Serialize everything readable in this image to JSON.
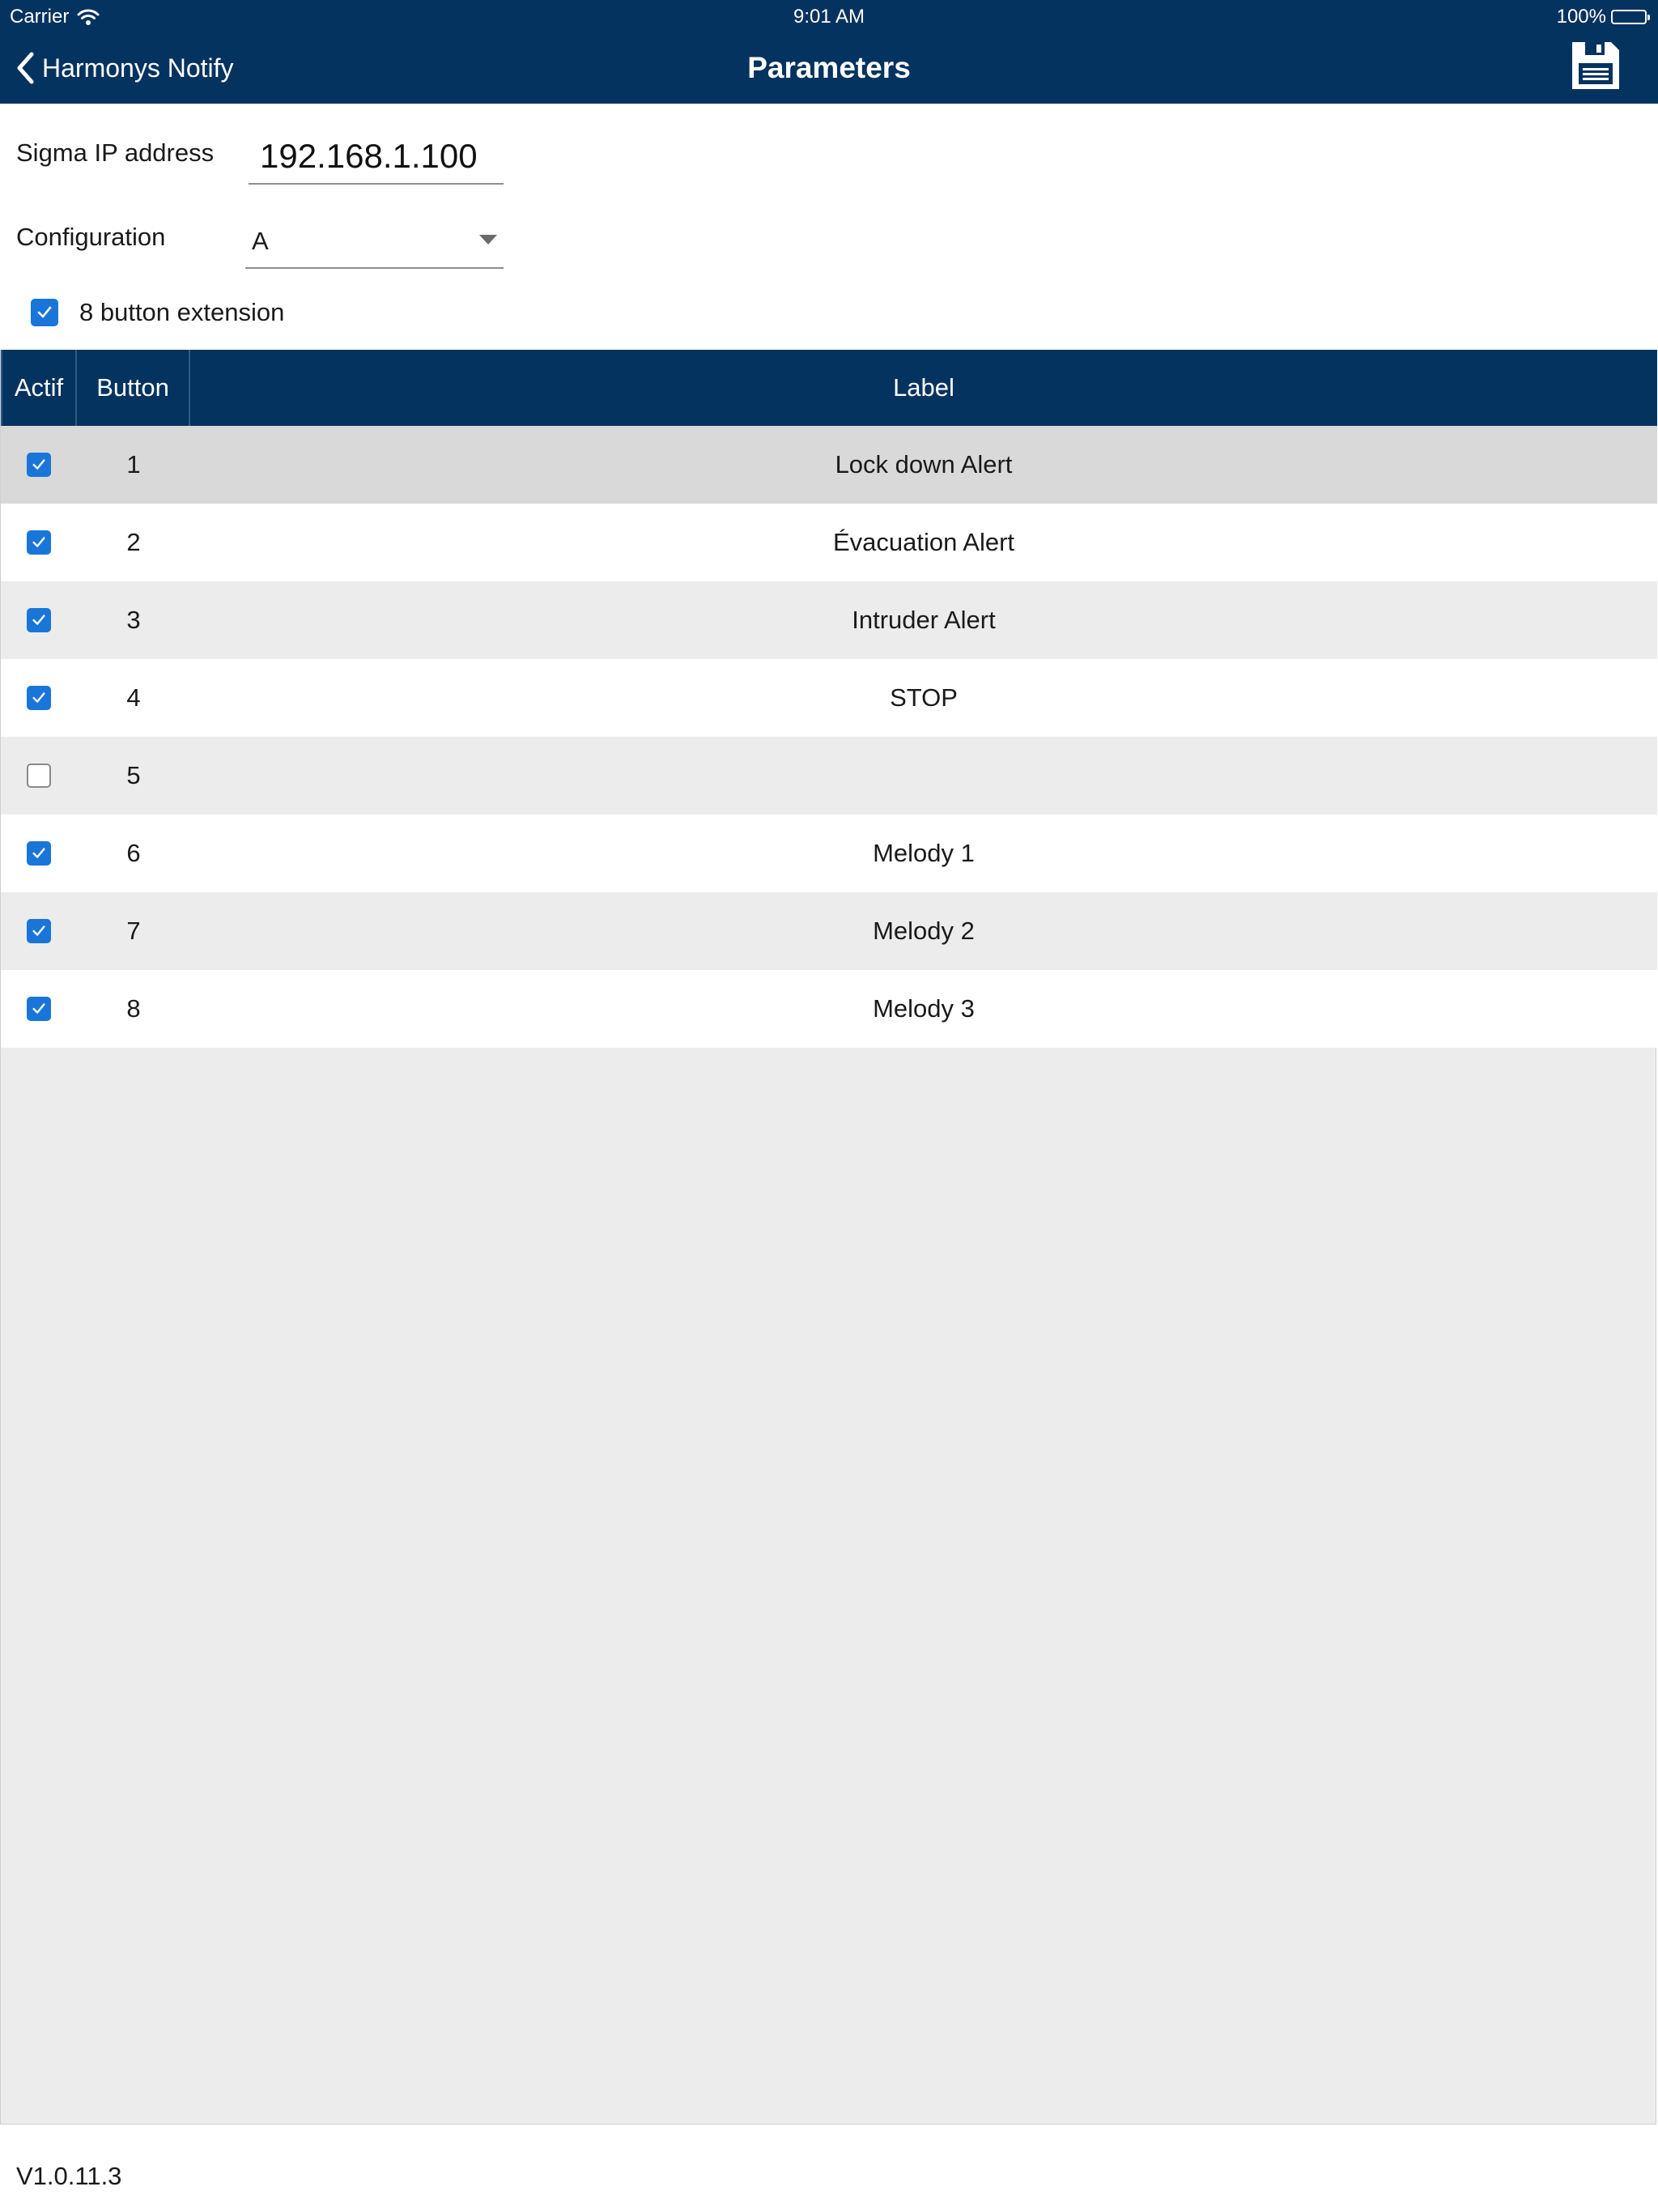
{
  "status_bar": {
    "carrier": "Carrier",
    "time": "9:01 AM",
    "battery": "100%"
  },
  "nav": {
    "back_label": "Harmonys Notify",
    "title": "Parameters",
    "save_icon": "floppy-disk-icon"
  },
  "form": {
    "ip_label": "Sigma IP address",
    "ip_value": "192.168.1.100",
    "config_label": "Configuration",
    "config_value": "A",
    "extension_label": "8 button extension",
    "extension_checked": true
  },
  "table": {
    "headers": {
      "actif": "Actif",
      "button": "Button",
      "label": "Label"
    },
    "rows": [
      {
        "active": true,
        "button": "1",
        "label": "Lock down Alert",
        "selected": true
      },
      {
        "active": true,
        "button": "2",
        "label": "Évacuation Alert"
      },
      {
        "active": true,
        "button": "3",
        "label": "Intruder Alert"
      },
      {
        "active": true,
        "button": "4",
        "label": "STOP"
      },
      {
        "active": false,
        "button": "5",
        "label": ""
      },
      {
        "active": true,
        "button": "6",
        "label": "Melody 1"
      },
      {
        "active": true,
        "button": "7",
        "label": "Melody 2"
      },
      {
        "active": true,
        "button": "8",
        "label": "Melody 3"
      }
    ]
  },
  "footer": {
    "version": "V1.0.11.3"
  },
  "colors": {
    "nav_background": "#05335f",
    "checkbox_checked": "#1976d8",
    "row_selected": "#d9d9d9",
    "row_even": "#ffffff",
    "row_odd": "#ececec"
  }
}
